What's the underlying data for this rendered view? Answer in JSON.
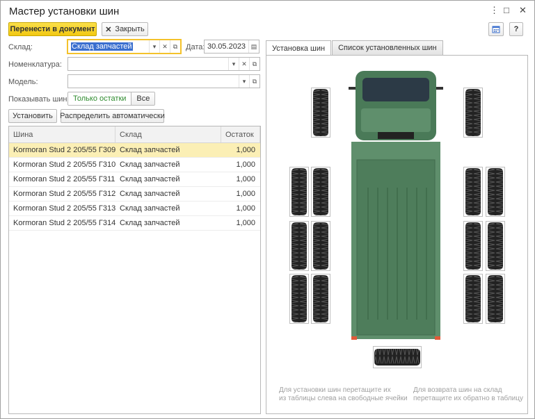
{
  "window": {
    "title": "Мастер установки шин"
  },
  "toolbar": {
    "transfer_label": "Перенести в документ",
    "close_label": "Закрыть",
    "close_icon": "x-icon"
  },
  "filters": {
    "warehouse_label": "Склад:",
    "warehouse_value": "Склад запчастей",
    "date_label": "Дата:",
    "date_value": "30.05.2023 19",
    "nomenclature_label": "Номенклатура:",
    "nomenclature_value": "",
    "model_label": "Модель:",
    "model_value": "",
    "show_label": "Показывать шины:",
    "show_only_rest": "Только остатки",
    "show_all": "Все"
  },
  "actions": {
    "install_label": "Установить",
    "auto_label": "Распределить автоматически"
  },
  "table": {
    "columns": [
      "Шина",
      "Склад",
      "Остаток"
    ],
    "rows": [
      [
        "Kormoran Stud 2 205/55 Г309",
        "Склад запчастей",
        "1,000"
      ],
      [
        "Kormoran Stud 2 205/55 Г310",
        "Склад запчастей",
        "1,000"
      ],
      [
        "Kormoran Stud 2 205/55 Г311",
        "Склад запчастей",
        "1,000"
      ],
      [
        "Kormoran Stud 2 205/55 Г312",
        "Склад запчастей",
        "1,000"
      ],
      [
        "Kormoran Stud 2 205/55 Г313",
        "Склад запчастей",
        "1,000"
      ],
      [
        "Kormoran Stud 2 205/55 Г314",
        "Склад запчастей",
        "1,000"
      ]
    ]
  },
  "tabs": {
    "install_tab": "Установка шин",
    "list_tab": "Список установленных шин"
  },
  "hints": {
    "left_line1": "Для установки шин перетащите их",
    "left_line2": "из таблицы слева на свободные ячейки",
    "right_line1": "Для возврата шин на склад",
    "right_line2": "перетащите их обратно в таблицу"
  },
  "colors": {
    "accent": "#f2c811",
    "truck_body": "#5f8f6c",
    "truck_cab": "#4a7a58",
    "selected_row": "#fbefb5"
  }
}
